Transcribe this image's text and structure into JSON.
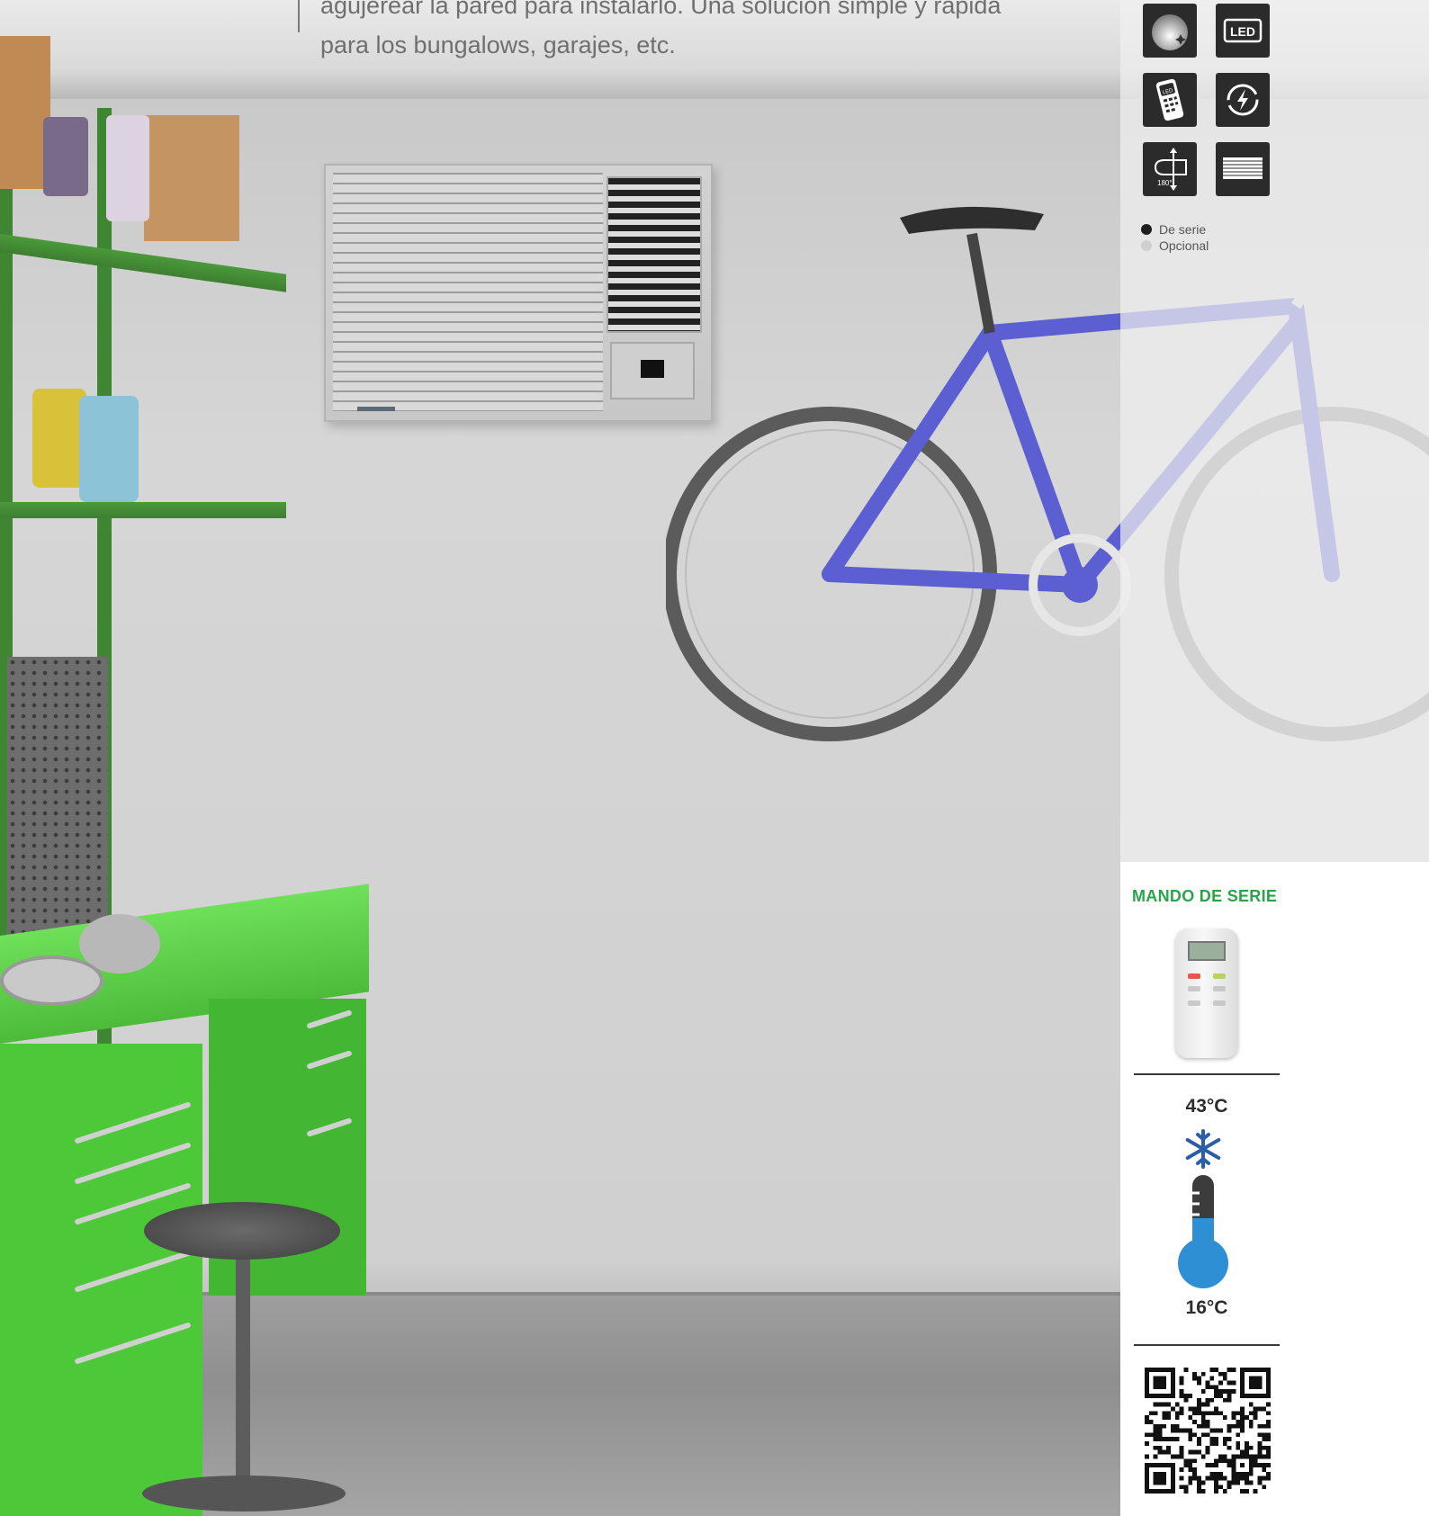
{
  "intro": {
    "line1": "agujerear la pared para instalarlo. Una solución simple y rápida",
    "line2": "para los bungalows, garajes, etc."
  },
  "features": {
    "icons": [
      "night-mode-icon",
      "led-display-icon",
      "led-remote-icon",
      "auto-restart-icon",
      "swing-180-icon",
      "filter-icon"
    ],
    "led_label": "LED",
    "remote_led_label": "LED",
    "swing_label": "180°"
  },
  "legend": {
    "standard": "De serie",
    "optional": "Opcional",
    "standard_color": "#1e1e1e",
    "optional_color": "#cfcfcf"
  },
  "remote_section": {
    "heading": "MANDO DE SERIE"
  },
  "temperature": {
    "max": "43°C",
    "min": "16°C",
    "mode_icon": "snowflake-icon",
    "thermometer_color": "#2f8fd4"
  },
  "colors": {
    "accent_green": "#2aa44a",
    "icon_bg": "#2b2b2b"
  }
}
